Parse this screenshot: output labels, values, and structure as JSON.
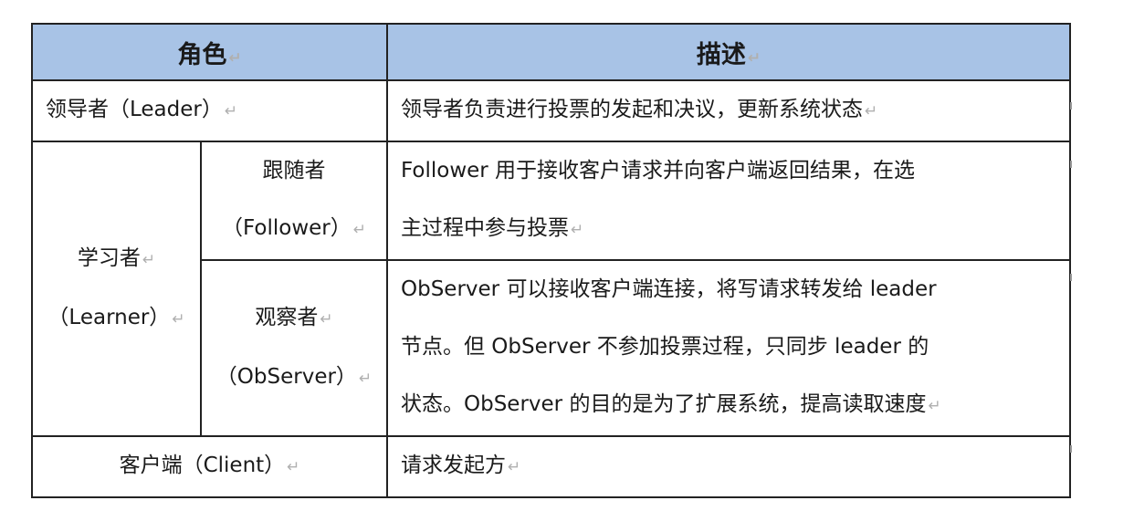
{
  "header": {
    "role": "角色",
    "description": "描述"
  },
  "rows": {
    "leader": {
      "role": "领导者（Leader）",
      "desc": "领导者负责进行投票的发起和决议，更新系统状态"
    },
    "learner": {
      "group_name": "学习者",
      "group_en": "（Learner）",
      "follower": {
        "name": "跟随者",
        "en": "（Follower）",
        "desc_lines": [
          "Follower 用于接收客户请求并向客户端返回结果，在选",
          "主过程中参与投票"
        ]
      },
      "observer": {
        "name": "观察者",
        "en": "（ObServer）",
        "desc_lines": [
          "ObServer 可以接收客户端连接，将写请求转发给 leader",
          "节点。但 ObServer 不参加投票过程，只同步 leader 的",
          "状态。ObServer 的目的是为了扩展系统，提高读取速度"
        ]
      }
    },
    "client": {
      "role": "客户端（Client）",
      "desc": "请求发起方"
    }
  },
  "return_mark": "↵"
}
